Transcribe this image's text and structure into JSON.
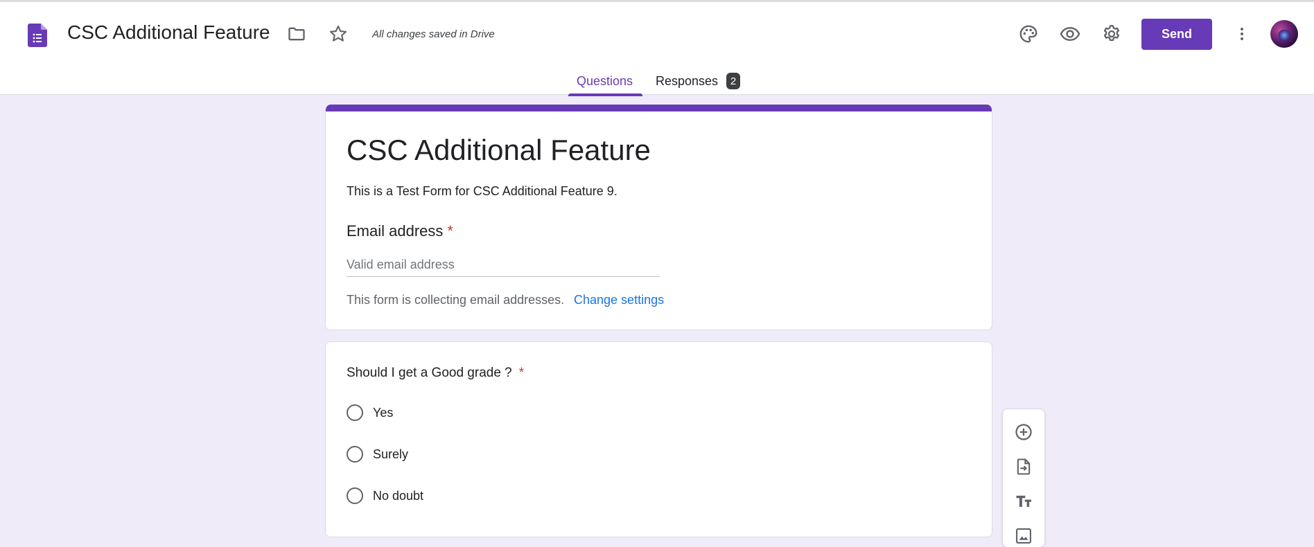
{
  "header": {
    "doc_title": "CSC Additional Feature",
    "saved_status": "All changes saved in Drive",
    "send_label": "Send",
    "icons": [
      "forms-logo-icon",
      "folder-icon",
      "star-icon",
      "palette-icon",
      "eye-preview-icon",
      "gear-icon",
      "more-vert-icon",
      "avatar"
    ]
  },
  "tabs": {
    "questions": "Questions",
    "responses": "Responses",
    "responses_count": "2"
  },
  "form": {
    "title": "CSC Additional Feature",
    "description": "This is a Test Form for CSC Additional Feature 9.",
    "email_label": "Email address",
    "required_mark": "*",
    "email_placeholder": "Valid email address",
    "collecting_text": "This form is collecting email addresses.",
    "change_settings": "Change settings"
  },
  "question": {
    "title": "Should I get a Good grade ?",
    "required_mark": "*",
    "options": [
      "Yes",
      "Surely",
      "No doubt"
    ]
  },
  "colors": {
    "accent": "#673ab7",
    "background": "#f0ebf8",
    "link": "#1a73e8",
    "required": "#d93025"
  },
  "side_toolbar": {
    "icons": [
      "add-question-icon",
      "import-questions-icon",
      "add-title-icon",
      "add-image-icon"
    ]
  }
}
